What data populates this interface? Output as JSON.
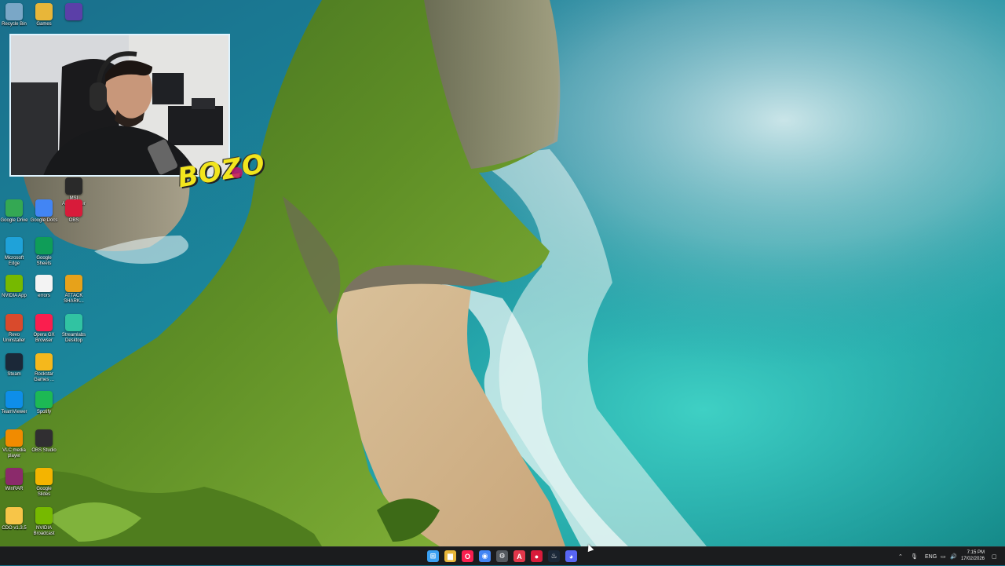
{
  "desktop": {
    "icons": [
      {
        "label": "Recycle Bin",
        "icon": "recycle-bin-icon",
        "color": "#7aa7c7"
      },
      {
        "label": "Games",
        "icon": "folder-icon",
        "color": "#e8b639"
      },
      {
        "label": "",
        "icon": "app-icon",
        "color": "#5b3fa8"
      },
      {
        "label": "MSI Afterburner",
        "icon": "afterburner-icon",
        "color": "#2a2a2a"
      },
      {
        "label": "Google Drive",
        "icon": "google-drive-icon",
        "color": "#34a853"
      },
      {
        "label": "Google Docs",
        "icon": "google-docs-icon",
        "color": "#4285f4"
      },
      {
        "label": "OBS",
        "icon": "obs-icon",
        "color": "#d81b3a"
      },
      {
        "label": "Microsoft Edge",
        "icon": "edge-icon",
        "color": "#1fa2d9"
      },
      {
        "label": "Google Sheets",
        "icon": "google-sheets-icon",
        "color": "#0f9d58"
      },
      {
        "label": "NVIDIA App",
        "icon": "nvidia-icon",
        "color": "#76b900"
      },
      {
        "label": "errors",
        "icon": "text-file-icon",
        "color": "#f3f3f3"
      },
      {
        "label": "ATTACK SHARK...",
        "icon": "attack-shark-icon",
        "color": "#e7a21a"
      },
      {
        "label": "Revo Uninstaller",
        "icon": "revo-icon",
        "color": "#d94a2c"
      },
      {
        "label": "Opera GX Browser",
        "icon": "opera-gx-icon",
        "color": "#fa1e4e"
      },
      {
        "label": "Streamlabs Desktop",
        "icon": "streamlabs-icon",
        "color": "#31c3a2"
      },
      {
        "label": "Steam",
        "icon": "steam-icon",
        "color": "#1b2838"
      },
      {
        "label": "Rockstar Games ...",
        "icon": "rockstar-icon",
        "color": "#f5b81c"
      },
      {
        "label": "TeamViewer",
        "icon": "teamviewer-icon",
        "color": "#0e8ee9"
      },
      {
        "label": "Spotify",
        "icon": "spotify-icon",
        "color": "#1db954"
      },
      {
        "label": "VLC media player",
        "icon": "vlc-icon",
        "color": "#f18b00"
      },
      {
        "label": "OBS Studio",
        "icon": "obs-studio-icon",
        "color": "#302e31"
      },
      {
        "label": "WinRAR",
        "icon": "winrar-icon",
        "color": "#8b2a6b"
      },
      {
        "label": "Google Slides",
        "icon": "google-slides-icon",
        "color": "#f4b400"
      },
      {
        "label": "CDO v1.3.5",
        "icon": "cdo-icon",
        "color": "#f7c548"
      },
      {
        "label": "NVIDIA Broadcast",
        "icon": "nvidia-broadcast-icon",
        "color": "#76b900"
      }
    ]
  },
  "webcam": {
    "watermark": "BOZO"
  },
  "taskbar": {
    "apps": [
      {
        "name": "start-button",
        "color": "#3aa0f3",
        "glyph": "⊞"
      },
      {
        "name": "file-explorer-icon",
        "color": "#e8b639",
        "glyph": "▆"
      },
      {
        "name": "opera-gx-icon",
        "color": "#fa1e4e",
        "glyph": "O"
      },
      {
        "name": "chrome-icon",
        "color": "#4285f4",
        "glyph": "◉"
      },
      {
        "name": "settings-icon",
        "color": "#555a60",
        "glyph": "⚙"
      },
      {
        "name": "app-a-icon",
        "color": "#e2374a",
        "glyph": "A"
      },
      {
        "name": "obs-icon",
        "color": "#d81b3a",
        "glyph": "●"
      },
      {
        "name": "steam-icon",
        "color": "#1b2838",
        "glyph": "♨"
      },
      {
        "name": "discord-icon",
        "color": "#5865f2",
        "glyph": "◕"
      }
    ],
    "tray": {
      "language": "ENG",
      "time": "7:15 PM",
      "date": "17/02/2026"
    }
  }
}
